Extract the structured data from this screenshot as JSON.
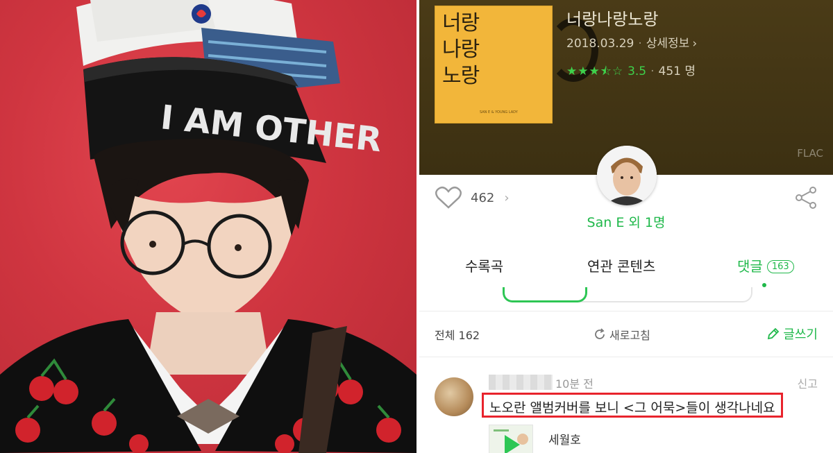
{
  "album": {
    "cover_text": "너랑\n나랑\n노랑",
    "cover_small": "SAN E & YOUNG LADY",
    "title": "너랑나랑노랑",
    "date": "2018.03.29",
    "detail_label": "상세정보",
    "rating_value": "3.5",
    "rating_count": "451 명",
    "rating_fraction": 0.7,
    "quality": "FLAC"
  },
  "artist": {
    "name": "San E 외 1명"
  },
  "actions": {
    "like_count": "462"
  },
  "tabs": [
    {
      "label": "수록곡"
    },
    {
      "label": "연관 콘텐츠"
    },
    {
      "label": "댓글",
      "badge": "163"
    }
  ],
  "comments_toolbar": {
    "total": "전체 162",
    "refresh_label": "새로고침",
    "write_label": "글쓰기"
  },
  "comment": {
    "time": "10분 전",
    "report_label": "신고",
    "text": "노오란 앨범커버를 보니 <그 어묵>들이 생각나네요",
    "attachment_title": "세월호"
  },
  "colors": {
    "accent_green": "#1fb84a",
    "header_brown": "#4a3b17",
    "highlight_red": "#e8232c",
    "cover_yellow": "#f2b63a"
  }
}
